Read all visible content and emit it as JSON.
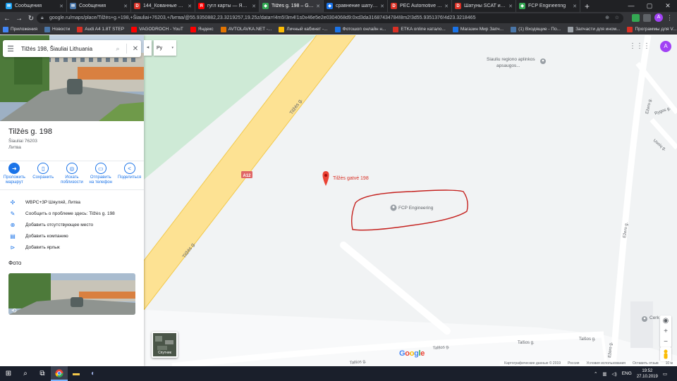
{
  "browser": {
    "tabs": [
      {
        "title": "Сообщения",
        "color": "#1da1f2",
        "glyph": "✉"
      },
      {
        "title": "Сообщения",
        "color": "#4a76a8",
        "glyph": "✉"
      },
      {
        "title": "144_Кованные шатуны",
        "color": "#d93025",
        "glyph": "D"
      },
      {
        "title": "гугл карты — Яндекс",
        "color": "#ff0000",
        "glyph": "Я"
      },
      {
        "title": "Tilžės g. 198 – Google",
        "color": "#34a853",
        "glyph": "◆",
        "active": true
      },
      {
        "title": "сравнение шатунов",
        "color": "#1a73e8",
        "glyph": "◆"
      },
      {
        "title": "PEC Automotive VS Aic",
        "color": "#d93025",
        "glyph": "D"
      },
      {
        "title": "Шатуны SCAT и перед",
        "color": "#d93025",
        "glyph": "D"
      },
      {
        "title": "FCP Engineering",
        "color": "#34a853",
        "glyph": "◆"
      }
    ],
    "url": "google.ru/maps/place/Tilžės+g.+198,+Šiauliai+76203,+Литва/@55.9350882,23.3219257,19.25z/data=!4m5!3m4!1s0x46e5e2e0304068d9:0xd3da31687434784!8m2!3d55.9351376!4d23.3218465",
    "profile_initial": "A",
    "bookmarks": [
      {
        "label": "Приложения",
        "color": "#4285f4"
      },
      {
        "label": "Новости",
        "color": "#4a76a8"
      },
      {
        "label": "Audi A4 1.8T STEP",
        "color": "#d93025"
      },
      {
        "label": "VAGODROCH - YouT",
        "color": "#ff0000"
      },
      {
        "label": "Яндекс",
        "color": "#ff0000"
      },
      {
        "label": "AVTOLAVKA.NET -...",
        "color": "#e37400"
      },
      {
        "label": "Личный кабинет -...",
        "color": "#fbbc04"
      },
      {
        "label": "Фотошоп онлайн н...",
        "color": "#1a73e8"
      },
      {
        "label": "ETKA online катало...",
        "color": "#d93025"
      },
      {
        "label": "Магазин Мир Запч...",
        "color": "#1a73e8"
      },
      {
        "label": "(1) Входящие - По...",
        "color": "#4a76a8"
      },
      {
        "label": "Запчасти для ином...",
        "color": "#9aa0a6"
      },
      {
        "label": "Программы для V...",
        "color": "#d93025"
      }
    ]
  },
  "sidebar": {
    "search_query": "Tilžės 198, Šiauliai Lithuania",
    "place_title": "Tilžės g. 198",
    "address_line1": "Šiauliai 76203",
    "address_line2": "Литва",
    "actions": [
      {
        "label": "Проложить маршрут",
        "icon": "directions-icon",
        "glyph": "➜",
        "filled": true
      },
      {
        "label": "Сохранить",
        "icon": "bookmark-icon",
        "glyph": "▯"
      },
      {
        "label": "Искать поблизости",
        "icon": "nearby-icon",
        "glyph": "◎"
      },
      {
        "label": "Отправить на телефон",
        "icon": "phone-icon",
        "glyph": "▭"
      },
      {
        "label": "Поделиться",
        "icon": "share-icon",
        "glyph": "<"
      }
    ],
    "rows": [
      {
        "label": "WBPC+3P Шяуляй, Литва",
        "icon": "plus-code-icon",
        "glyph": "✣"
      },
      {
        "label": "Сообщить о проблеме здесь: Tilžės g. 198",
        "icon": "edit-icon",
        "glyph": "✎"
      },
      {
        "label": "Добавить отсутствующее место",
        "icon": "add-place-icon",
        "glyph": "⊕"
      },
      {
        "label": "Добавить компанию",
        "icon": "business-icon",
        "glyph": "▤"
      },
      {
        "label": "Добавить ярлык",
        "icon": "label-icon",
        "glyph": "⊳"
      }
    ],
    "photos_heading": "Фото"
  },
  "map": {
    "lang_button": "Ру",
    "pin_label": "Tilžės gatvė 198",
    "poi_label": "FCP Engineering",
    "poi2_label_line1": "Siauliu regiono aplinkos",
    "poi2_label_line2": "apsaugos...",
    "poi3_label": "Cerk",
    "road_labels": {
      "tilzes": "Tilžės g.",
      "ezero": "Ežero g.",
      "rygos": "Rygos g.",
      "uosiu": "Uosių g.",
      "talsos": "Talšos g.",
      "a12": "A12"
    },
    "satellite_label": "Спутник",
    "google_letters": [
      "G",
      "o",
      "o",
      "g",
      "l",
      "e"
    ],
    "footer": [
      "Картографические данные © 2019",
      "Россия",
      "Условия использования",
      "Оставить отзыв",
      "10 м"
    ]
  },
  "taskbar": {
    "lang": "ENG",
    "time": "19:52",
    "date": "27.10.2019"
  },
  "colors": {
    "pin_red": "#ea4335",
    "annotation_red": "#c5221f",
    "road_yellow": "#fde293",
    "park_green": "#ceead6",
    "accent_blue": "#1a73e8"
  }
}
